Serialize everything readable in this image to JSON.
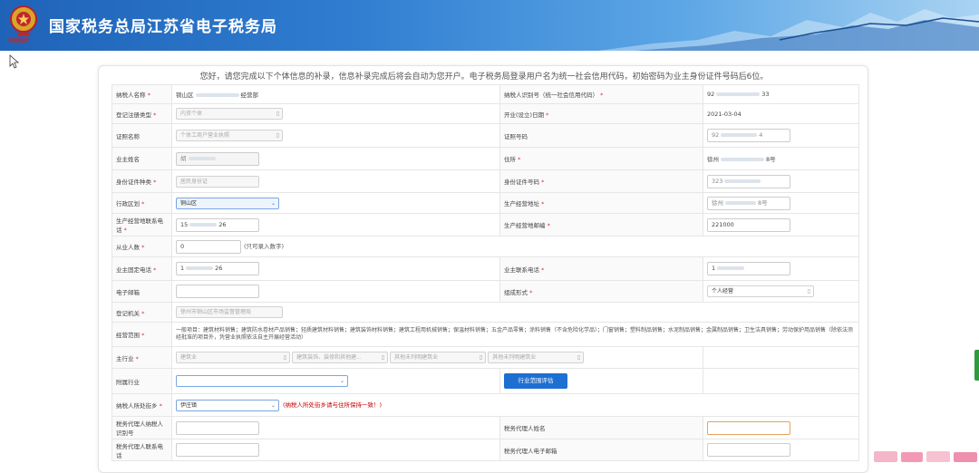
{
  "header": {
    "title": "国家税务总局江苏省电子税务局",
    "emblem_caption": "中国税务",
    "colors": {
      "bar_start": "#1f63b8",
      "bar_end": "#a9d3f2"
    }
  },
  "notice": "您好，请您完成以下个体信息的补录，信息补录完成后将会自动为您开户。电子税务局登录用户名为统一社会信用代码，初始密码为业主身份证件号码后6位。",
  "form": {
    "taxpayer_name_label": "纳税人名称",
    "taxpayer_name_value_prefix": "铜山区",
    "taxpayer_name_value_suffix": "经营部",
    "tax_id_label": "纳税人识别号（统一社会信用代码）",
    "tax_id_value_prefix": "92",
    "tax_id_value_suffix": "33",
    "reg_type_label": "登记注册类型",
    "reg_type_value": "内资个体",
    "open_date_label": "开业(设立)日期",
    "open_date_value": "2021-03-04",
    "cert_name_label": "证照名称",
    "cert_name_value": "个体工商户营业执照",
    "cert_no_label": "证照号码",
    "cert_no_prefix": "92",
    "cert_no_suffix": "4",
    "owner_name_label": "业主姓名",
    "owner_name_value": "胡",
    "address_label": "住所",
    "address_prefix": "徐州",
    "address_suffix": "8号",
    "id_type_label": "身份证件种类",
    "id_type_value": "居民身份证",
    "id_no_label": "身份证件号码",
    "id_no_prefix": "323",
    "district_label": "行政区划",
    "district_value": "铜山区",
    "biz_address_label": "生产经营地址",
    "biz_address_prefix": "徐州",
    "biz_address_suffix": "8号",
    "biz_phone_label": "生产经营地联系电话",
    "biz_phone_prefix": "15",
    "biz_phone_suffix": "26",
    "biz_postcode_label": "生产经营地邮编",
    "biz_postcode_value": "221000",
    "employees_label": "从业人数",
    "employees_value": "0",
    "employees_hint": "(只可录入数字)",
    "owner_phone_label": "业主固定电话",
    "owner_phone_prefix": "1",
    "owner_phone_suffix": "26",
    "owner_mobile_label": "业主联系电话",
    "owner_mobile_prefix": "1",
    "email_label": "电子邮箱",
    "org_form_label": "组成形式",
    "org_form_value": "个人经营",
    "reg_authority_label": "登记机关",
    "reg_authority_value": "徐州市铜山区市场监督管理局",
    "biz_scope_label": "经营范围",
    "biz_scope_value": "一般项目：建筑材料销售；建筑防水卷材产品销售；轻质建筑材料销售；建筑装饰材料销售；建筑工程用机械销售；保温材料销售；五金产品零售；涂料销售（不含危险化学品）；门窗销售；塑料制品销售；水泥制品销售；金属制品销售；卫生洁具销售；劳动保护用品销售（除依法须经批准的项目外，凭营业执照依法自主开展经营活动）",
    "main_industry_label": "主行业",
    "industry_1": "建筑业",
    "industry_2": "建筑装饰、装修和其他建...",
    "industry_3": "其他未列明建筑业",
    "industry_4": "其他未列明建筑业",
    "sub_industry_label": "附属行业",
    "scope_eval_button": "行业范围评估",
    "street_label": "纳税人所处街乡",
    "street_value": "伊庄镇",
    "street_warning": "(纳税人所处街乡请与住所保持一致！)",
    "agent_tax_id_label": "税务代理人纳税人识别号",
    "agent_name_label": "税务代理人姓名",
    "agent_phone_label": "税务代理人联系电话",
    "agent_email_label": "税务代理人电子邮箱",
    "required_mark": "*"
  }
}
